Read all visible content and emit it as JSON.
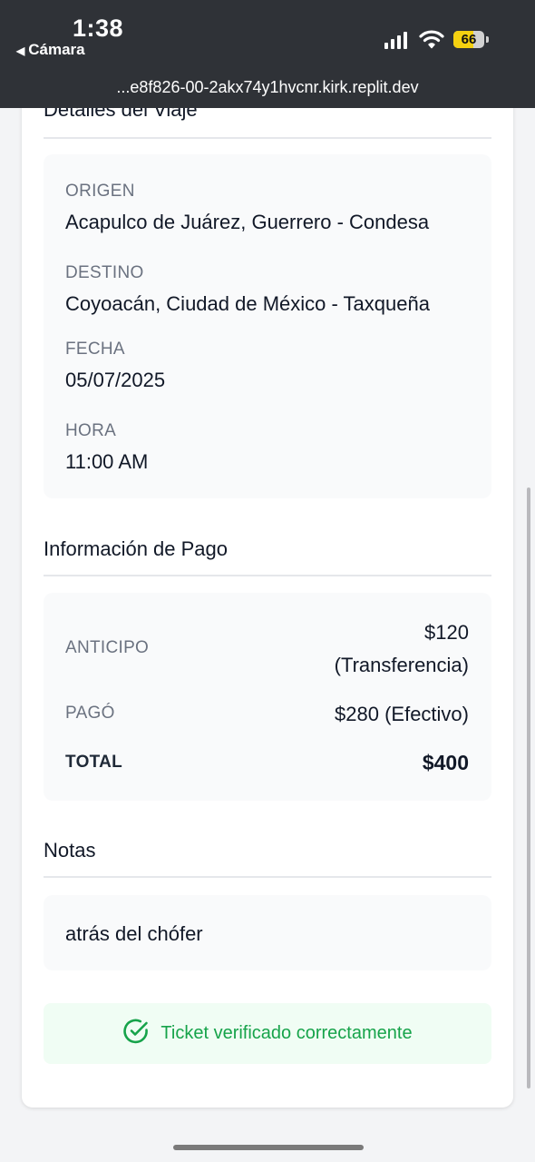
{
  "status_bar": {
    "time": "1:38",
    "back_label": "Cámara",
    "battery": "66",
    "battery_level": 0.66
  },
  "browser": {
    "url": "...e8f826-00-2akx74y1hvcnr.kirk.replit.dev"
  },
  "trip": {
    "title": "Detalles del Viaje",
    "origin_label": "ORIGEN",
    "origin_value": "Acapulco de Juárez, Guerrero - Condesa",
    "destination_label": "DESTINO",
    "destination_value": "Coyoacán, Ciudad de México - Taxqueña",
    "date_label": "FECHA",
    "date_value": "05/07/2025",
    "time_label": "HORA",
    "time_value": "11:00 AM"
  },
  "payment": {
    "title": "Información de Pago",
    "advance_label": "ANTICIPO",
    "advance_amount": "$120",
    "advance_method": "(Transferencia)",
    "paid_label": "PAGÓ",
    "paid_value": "$280 (Efectivo)",
    "total_label": "TOTAL",
    "total_value": "$400"
  },
  "notes": {
    "title": "Notas",
    "text": "atrás del chófer"
  },
  "verification": {
    "message": "Ticket verificado correctamente",
    "icon": "check-circle-icon",
    "color": "#16a34a"
  }
}
